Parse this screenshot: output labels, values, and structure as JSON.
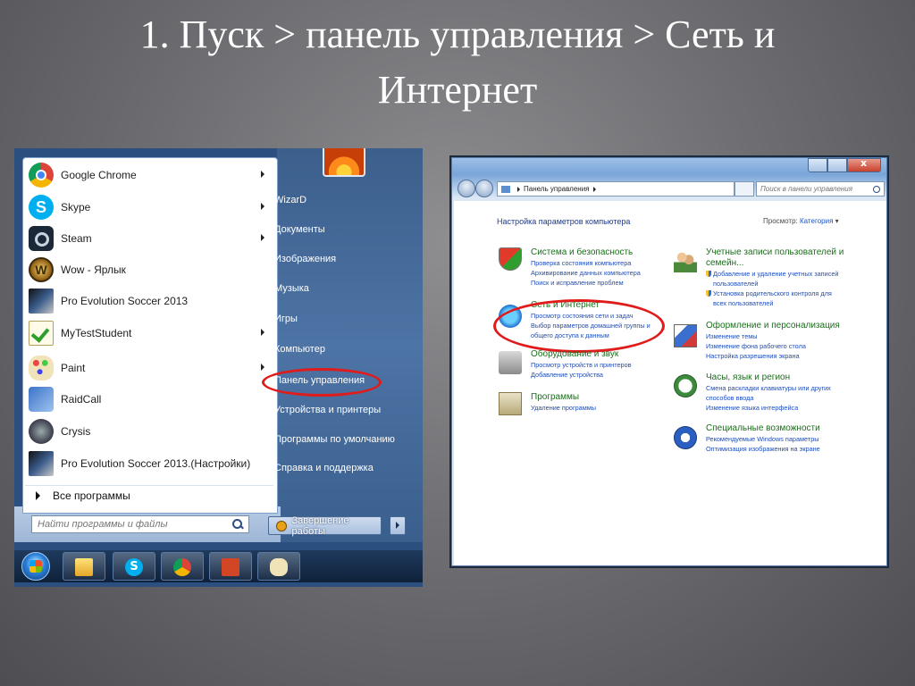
{
  "slide": {
    "title_line1": "1. Пуск > панель управления > Сеть и",
    "title_line2": "Интернет"
  },
  "start_menu": {
    "programs": [
      {
        "label": "Google Chrome",
        "icon": "chrome-icon",
        "has_submenu": true
      },
      {
        "label": "Skype",
        "icon": "skype-icon",
        "has_submenu": true
      },
      {
        "label": "Steam",
        "icon": "steam-icon",
        "has_submenu": true
      },
      {
        "label": "Wow - Ярлык",
        "icon": "wow-icon",
        "has_submenu": false
      },
      {
        "label": "Pro Evolution Soccer 2013",
        "icon": "pes-icon",
        "has_submenu": false
      },
      {
        "label": "MyTestStudent",
        "icon": "checkmark-icon",
        "has_submenu": true
      },
      {
        "label": "Paint",
        "icon": "paint-palette-icon",
        "has_submenu": true
      },
      {
        "label": "RaidCall",
        "icon": "raidcall-icon",
        "has_submenu": false
      },
      {
        "label": "Crysis",
        "icon": "crysis-icon",
        "has_submenu": false
      },
      {
        "label": "Pro Evolution Soccer 2013.(Настройки)",
        "icon": "pes-icon",
        "has_submenu": false
      }
    ],
    "all_programs": "Все программы",
    "search_placeholder": "Найти программы и файлы",
    "right": {
      "user": "WizarD",
      "documents": "Документы",
      "images": "Изображения",
      "music": "Музыка",
      "games": "Игры",
      "computer": "Компьютер",
      "control_panel": "Панель управления",
      "devices": "Устройства и принтеры",
      "defaults": "Программы по умолчанию",
      "help": "Справка и поддержка"
    },
    "shutdown": "Завершение работы",
    "highlight_color": "#e11a1a",
    "taskbar_icons": [
      "windows-orb-icon",
      "explorer-folder-icon",
      "skype-icon",
      "chrome-icon",
      "powerpoint-icon",
      "paint-palette-icon"
    ]
  },
  "control_panel": {
    "breadcrumb": "Панель управления",
    "search_placeholder": "Поиск в панели управления",
    "heading": "Настройка параметров компьютера",
    "view_label": "Просмотр:",
    "view_value": "Категория",
    "categories_left": [
      {
        "title": "Система и безопасность",
        "icon": "shield-icon",
        "links": [
          "Проверка состояния компьютера",
          "Архивирование данных компьютера",
          "Поиск и исправление проблем"
        ]
      },
      {
        "title": "Сеть и Интернет",
        "icon": "network-icon",
        "links": [
          "Просмотр состояния сети и задач",
          "Выбор параметров домашней группы и",
          "общего доступа к данным"
        ]
      },
      {
        "title": "Оборудование и звук",
        "icon": "printer-icon",
        "links": [
          "Просмотр устройств и принтеров",
          "Добавление устройства"
        ]
      },
      {
        "title": "Программы",
        "icon": "programs-icon",
        "links": [
          "Удаление программы"
        ]
      }
    ],
    "categories_right": [
      {
        "title": "Учетные записи пользователей и",
        "title2": "семейн...",
        "icon": "users-icon",
        "links": [
          "Добавление и удаление учетных записей",
          "пользователей",
          "Установка родительского контроля для",
          "всех пользователей"
        ]
      },
      {
        "title": "Оформление и персонализация",
        "icon": "appearance-icon",
        "links": [
          "Изменение темы",
          "Изменение фона рабочего стола",
          "Настройка разрешения экрана"
        ]
      },
      {
        "title": "Часы, язык и регион",
        "icon": "clock-globe-icon",
        "links": [
          "Смена раскладки клавиатуры или других",
          "способов ввода",
          "Изменение языка интерфейса"
        ]
      },
      {
        "title": "Специальные возможности",
        "icon": "accessibility-icon",
        "links": [
          "Рекомендуемые Windows параметры",
          "Оптимизация изображения на экране"
        ]
      }
    ]
  }
}
